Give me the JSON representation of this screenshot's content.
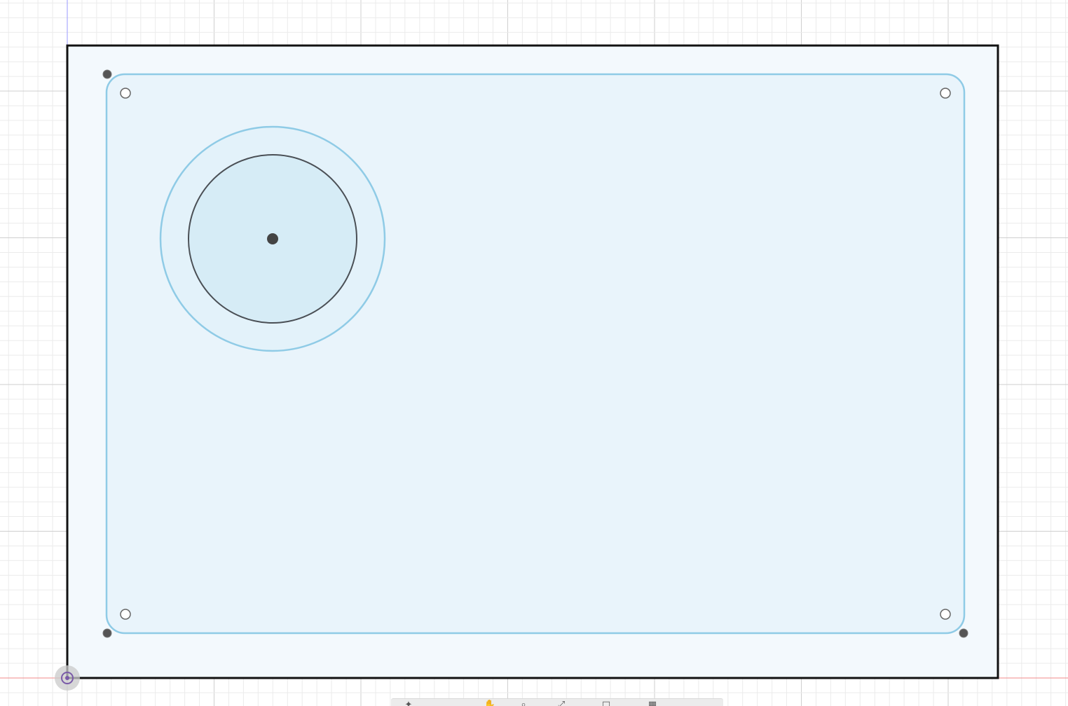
{
  "canvas": {
    "background": "#ffffff",
    "grid_minor_color": "#ebebeb",
    "grid_major_color": "#cfcfcf"
  },
  "sketch": {
    "outline_color": "#111111",
    "construction_color": "#8fcbe6",
    "profile_fill": "#e6f3fa",
    "circle_fill": "#d6ecf6",
    "point_color": "#555555"
  },
  "navbar": {
    "tools": [
      {
        "icon": "orbit-icon"
      },
      {
        "icon": "pan-icon"
      },
      {
        "icon": "zoom-icon"
      },
      {
        "icon": "fit-icon"
      },
      {
        "icon": "display-settings-icon"
      },
      {
        "icon": "grid-settings-icon"
      }
    ]
  }
}
